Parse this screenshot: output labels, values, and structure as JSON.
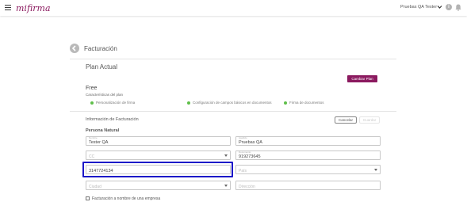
{
  "header": {
    "logo_text": "mifirma",
    "user_name": "Pruebas QA Tester"
  },
  "page": {
    "title": "Facturación"
  },
  "plan": {
    "section_title": "Plan Actual",
    "change_button": "Cambiar Plan",
    "name": "Free",
    "subtitle": "Características del plan",
    "features": [
      "Personalización de firma",
      "Configuración de campos básicos en documentos",
      "Firma de documentos"
    ]
  },
  "billing": {
    "title": "Información de Facturación",
    "cancel_button": "Cancelar",
    "save_button": "Guardar",
    "person_type": "Persona Natural",
    "fields": {
      "first_name": {
        "label": "Nombre",
        "value": "Tester QA"
      },
      "last_name": {
        "label": "Apellido",
        "value": "Pruebas QA"
      },
      "id_type": {
        "label": "",
        "value": "CC"
      },
      "document": {
        "label": "Documento",
        "value": "919273645"
      },
      "phone": {
        "label": "",
        "value": "3147724134"
      },
      "country": {
        "placeholder": "País"
      },
      "city": {
        "placeholder": "Ciudad"
      },
      "address": {
        "placeholder": "Dirección"
      }
    },
    "company_checkbox_label": "Facturación a nombre de una empresa"
  },
  "colors": {
    "accent": "#8b1a5f",
    "feature_dot": "#5fbf4a",
    "highlight": "#1b16c8"
  }
}
